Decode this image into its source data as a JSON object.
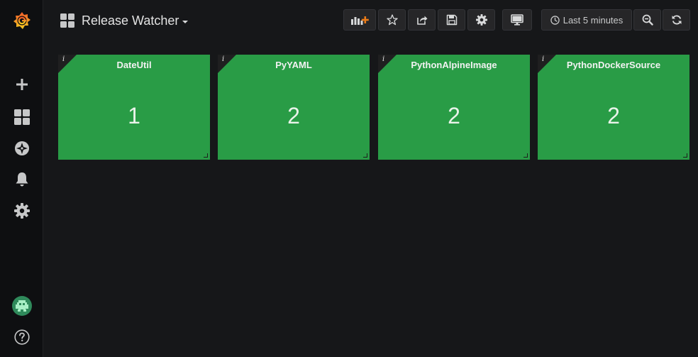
{
  "app": {
    "logo": "grafana-logo-icon",
    "accent_color": "#eb7b18"
  },
  "sidebar": {
    "items": [
      {
        "name": "create",
        "icon": "plus-icon"
      },
      {
        "name": "dashboards",
        "icon": "dashboards-grid-icon"
      },
      {
        "name": "explore",
        "icon": "compass-icon"
      },
      {
        "name": "alerting",
        "icon": "bell-icon"
      },
      {
        "name": "configuration",
        "icon": "gear-icon"
      }
    ],
    "bottom": [
      {
        "name": "profile",
        "icon": "avatar-icon"
      },
      {
        "name": "help",
        "icon": "help-icon"
      }
    ]
  },
  "navbar": {
    "dashboard_title": "Release Watcher",
    "buttons": [
      {
        "name": "add-panel",
        "icon": "add-panel-icon"
      },
      {
        "name": "star",
        "icon": "star-icon"
      },
      {
        "name": "share",
        "icon": "share-icon"
      },
      {
        "name": "save",
        "icon": "save-icon"
      },
      {
        "name": "settings",
        "icon": "gear-icon"
      },
      {
        "name": "cycle-view",
        "icon": "monitor-icon"
      },
      {
        "name": "zoom-out",
        "icon": "zoom-out-icon"
      },
      {
        "name": "refresh",
        "icon": "refresh-icon"
      }
    ],
    "time_picker": {
      "icon": "clock-icon",
      "label": "Last 5 minutes"
    }
  },
  "panels": [
    {
      "title": "DateUtil",
      "value": "1",
      "info": "i",
      "color": "#299c46"
    },
    {
      "title": "PyYAML",
      "value": "2",
      "info": "i",
      "color": "#299c46"
    },
    {
      "title": "PythonAlpineImage",
      "value": "2",
      "info": "i",
      "color": "#299c46"
    },
    {
      "title": "PythonDockerSource",
      "value": "2",
      "info": "i",
      "color": "#299c46"
    }
  ]
}
